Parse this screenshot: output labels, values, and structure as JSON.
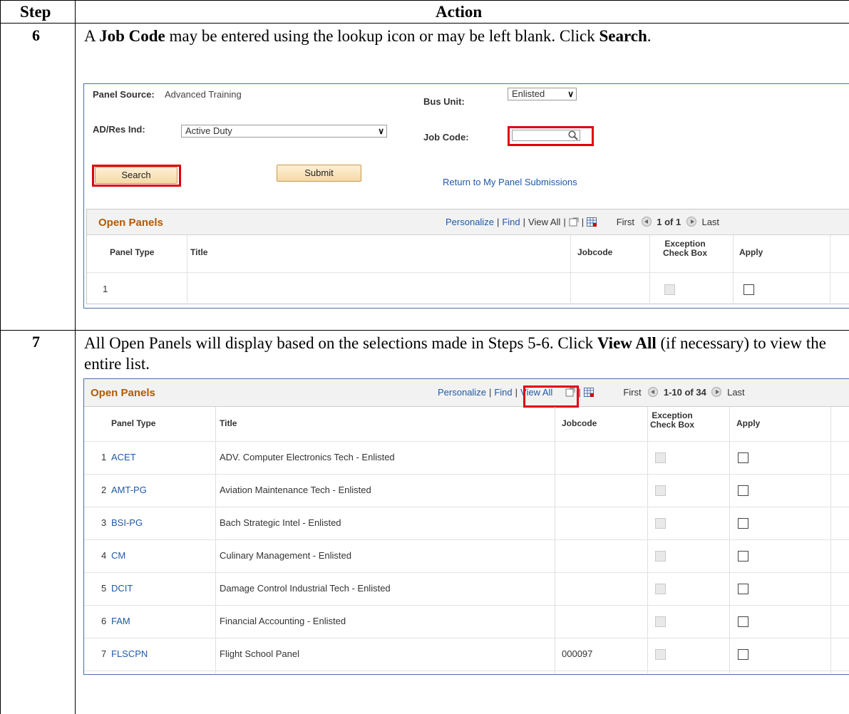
{
  "table": {
    "col_step": "Step",
    "col_action": "Action"
  },
  "step6": {
    "number": "6",
    "text_pre": "A ",
    "text_bold1": "Job Code",
    "text_mid": " may be entered using the lookup icon or may be left blank.  Click ",
    "text_bold2": "Search",
    "text_post": "."
  },
  "step7": {
    "number": "7",
    "text_pre": "All Open Panels will display based on the selections made in Steps 5-6.  Click ",
    "text_bold1": "View All",
    "text_post": " (if necessary) to view the entire list."
  },
  "form": {
    "panel_source_label": "Panel Source:",
    "panel_source_value": "Advanced Training",
    "bus_unit_label": "Bus Unit:",
    "bus_unit_value": "Enlisted",
    "adres_label": "AD/Res Ind:",
    "adres_value": "Active Duty",
    "job_code_label": "Job Code:",
    "job_code_value": "",
    "search_button": "Search",
    "submit_button": "Submit",
    "return_link": "Return to My Panel Submissions"
  },
  "grid1": {
    "title": "Open Panels",
    "personalize": "Personalize",
    "find": "Find",
    "view_all": "View All",
    "first": "First",
    "range": "1 of 1",
    "last": "Last",
    "headers": {
      "panel_type": "Panel Type",
      "title": "Title",
      "jobcode": "Jobcode",
      "exception": "Exception Check Box",
      "apply": "Apply"
    },
    "rows": [
      {
        "num": "1",
        "panel_type": "",
        "title": "",
        "jobcode": ""
      }
    ]
  },
  "grid2": {
    "title": "Open Panels",
    "personalize": "Personalize",
    "find": "Find",
    "view_all": "View All",
    "first": "First",
    "range": "1-10 of 34",
    "last": "Last",
    "headers": {
      "panel_type": "Panel Type",
      "title": "Title",
      "jobcode": "Jobcode",
      "exception": "Exception Check Box",
      "apply": "Apply"
    },
    "rows": [
      {
        "num": "1",
        "panel_type": "ACET",
        "title": "ADV. Computer Electronics Tech - Enlisted",
        "jobcode": ""
      },
      {
        "num": "2",
        "panel_type": "AMT-PG",
        "title": "Aviation Maintenance Tech - Enlisted",
        "jobcode": ""
      },
      {
        "num": "3",
        "panel_type": "BSI-PG",
        "title": "Bach Strategic Intel - Enlisted",
        "jobcode": ""
      },
      {
        "num": "4",
        "panel_type": "CM",
        "title": "Culinary Management - Enlisted",
        "jobcode": ""
      },
      {
        "num": "5",
        "panel_type": "DCIT",
        "title": "Damage Control Industrial Tech - Enlisted",
        "jobcode": ""
      },
      {
        "num": "6",
        "panel_type": "FAM",
        "title": "Financial Accounting - Enlisted",
        "jobcode": ""
      },
      {
        "num": "7",
        "panel_type": "FLSCPN",
        "title": "Flight School Panel",
        "jobcode": "000097"
      }
    ]
  }
}
